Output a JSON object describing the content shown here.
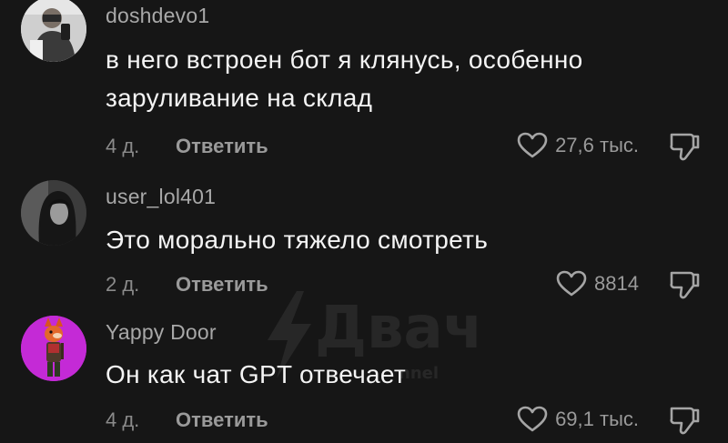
{
  "watermark": {
    "text": "Двач",
    "subtext": "nnel"
  },
  "comments": [
    {
      "username": "doshdevo1",
      "text": "в него встроен бот я клянусь, особенно заруливание на склад",
      "time": "4 д.",
      "reply_label": "Ответить",
      "likes": "27,6 тыс.",
      "avatar_icon": "person-photo-avatar"
    },
    {
      "username": "user_lol401",
      "text": "Это морально тяжело смотреть",
      "time": "2 д.",
      "reply_label": "Ответить",
      "likes": "8814",
      "avatar_icon": "dark-portrait-avatar"
    },
    {
      "username": "Yappy Door",
      "text": "Он как чат GPT отвечает",
      "time": "4 д.",
      "reply_label": "Ответить",
      "likes": "69,1 тыс.",
      "avatar_icon": "cartoon-fox-avatar"
    }
  ],
  "colors": {
    "background": "#161616",
    "text": "#f4f4f4",
    "secondary": "#9a9a9a",
    "avatar_purple": "#c42ad6"
  }
}
